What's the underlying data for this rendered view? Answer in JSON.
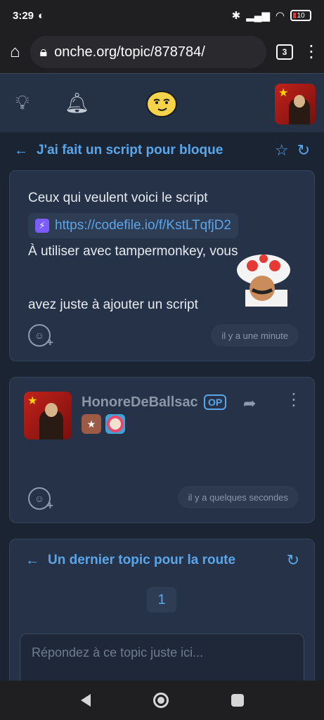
{
  "status_bar": {
    "time": "3:29",
    "battery": "10"
  },
  "browser": {
    "url": "onche.org/topic/878784/",
    "tab_count": "3"
  },
  "topic": {
    "title": "J'ai fait un script pour bloque"
  },
  "post1": {
    "line1": "Ceux qui veulent voici le script",
    "link": "https://codefile.io/f/KstLTqfjD2",
    "line3": "À utiliser avec tampermonkey, vous",
    "line4": "avez juste à ajouter un script",
    "timestamp": "il y a une minute"
  },
  "post2": {
    "username": "HonoreDeBallsac",
    "op_badge": "OP",
    "timestamp": "il y a quelques secondes"
  },
  "next_topic": {
    "title": "Un dernier topic pour la route",
    "page": "1",
    "reply_placeholder": "Répondez à ce topic juste ici..."
  },
  "colors": {
    "accent": "#5aa6ea",
    "background": "#1b2433",
    "card": "#263247"
  }
}
